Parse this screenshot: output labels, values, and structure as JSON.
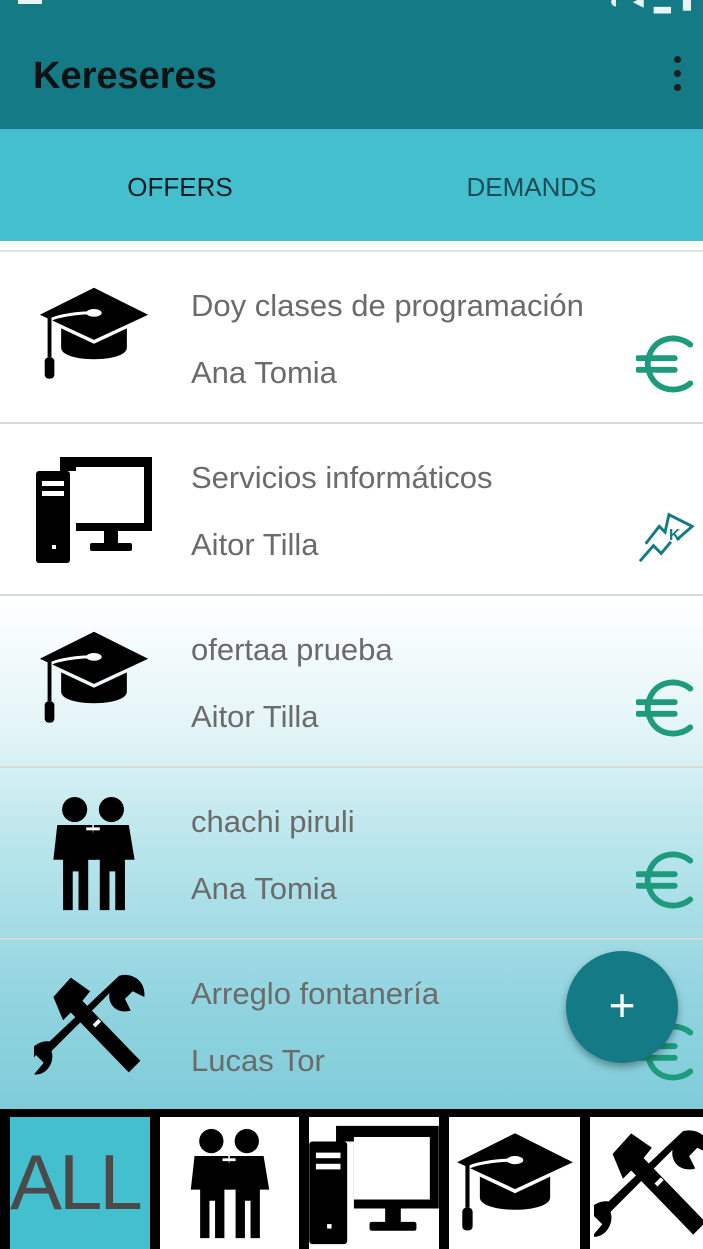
{
  "app": {
    "title": "Kereseres"
  },
  "tabs": [
    {
      "label": "OFFERS",
      "selected": true
    },
    {
      "label": "DEMANDS",
      "selected": false
    }
  ],
  "items": [
    {
      "title": "Doy clases de programación",
      "author": "Ana Tomia",
      "icon": "graduation-cap-icon",
      "payment": "euro-icon"
    },
    {
      "title": "Servicios informáticos",
      "author": "Aitor Tilla",
      "icon": "desktop-computer-icon",
      "payment": "k-flag-icon"
    },
    {
      "title": "ofertaa prueba",
      "author": "Aitor Tilla",
      "icon": "graduation-cap-icon",
      "payment": "euro-icon"
    },
    {
      "title": "chachi piruli",
      "author": "Ana Tomia",
      "icon": "two-people-icon",
      "payment": "euro-icon"
    },
    {
      "title": "Arreglo fontanería",
      "author": "Lucas Tor",
      "icon": "hammer-wrench-icon",
      "payment": "euro-icon"
    }
  ],
  "fab": {
    "symbol": "+"
  },
  "categories": [
    {
      "label": "ALL",
      "selected": true
    },
    {
      "icon": "two-people-icon"
    },
    {
      "icon": "desktop-computer-icon"
    },
    {
      "icon": "graduation-cap-icon"
    },
    {
      "icon": "hammer-wrench-icon"
    }
  ],
  "colors": {
    "primary": "#137a86",
    "tabs_background": "#44bfcd",
    "tab_indicator": "#9c27b0",
    "euro": "#1e9a7c",
    "text_secondary": "#6b6b6b"
  }
}
